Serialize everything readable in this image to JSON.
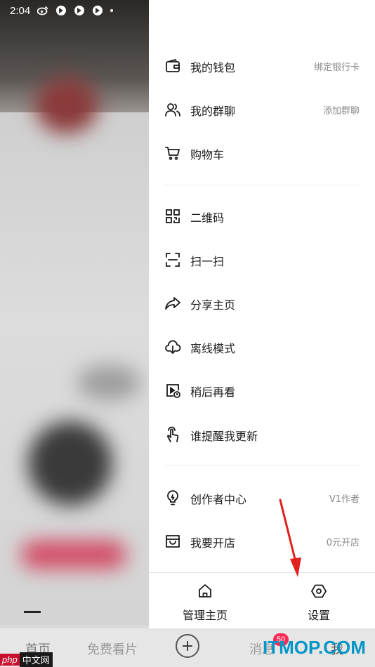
{
  "status_bar": {
    "time": "2:04"
  },
  "drawer": {
    "group1": [
      {
        "label": "我的钱包",
        "right": "绑定银行卡",
        "icon": "wallet-icon"
      },
      {
        "label": "我的群聊",
        "right": "添加群聊",
        "icon": "group-chat-icon"
      },
      {
        "label": "购物车",
        "right": "",
        "icon": "cart-icon"
      }
    ],
    "group2": [
      {
        "label": "二维码",
        "icon": "qr-code-icon"
      },
      {
        "label": "扫一扫",
        "icon": "scan-icon"
      },
      {
        "label": "分享主页",
        "icon": "share-icon"
      },
      {
        "label": "离线模式",
        "icon": "download-cloud-icon"
      },
      {
        "label": "稍后再看",
        "icon": "watch-later-icon"
      },
      {
        "label": "谁提醒我更新",
        "icon": "tap-hand-icon"
      }
    ],
    "group3": [
      {
        "label": "创作者中心",
        "right": "V1作者",
        "icon": "lightbulb-icon"
      },
      {
        "label": "我要开店",
        "right": "0元开店",
        "icon": "shop-icon"
      }
    ],
    "footer": {
      "manage_label": "管理主页",
      "settings_label": "设置"
    }
  },
  "bottom_nav": {
    "home": "首页",
    "free": "免费看片",
    "plus": "+",
    "messages": "消息",
    "messages_badge": "50",
    "me": "我"
  },
  "watermarks": {
    "php_a": "php",
    "php_b": "中文网",
    "itmop": "ITMOP.COM"
  },
  "colors": {
    "badge": "#fe2c55",
    "watermark_blue": "#0096c8",
    "arrow": "#e0201c"
  }
}
